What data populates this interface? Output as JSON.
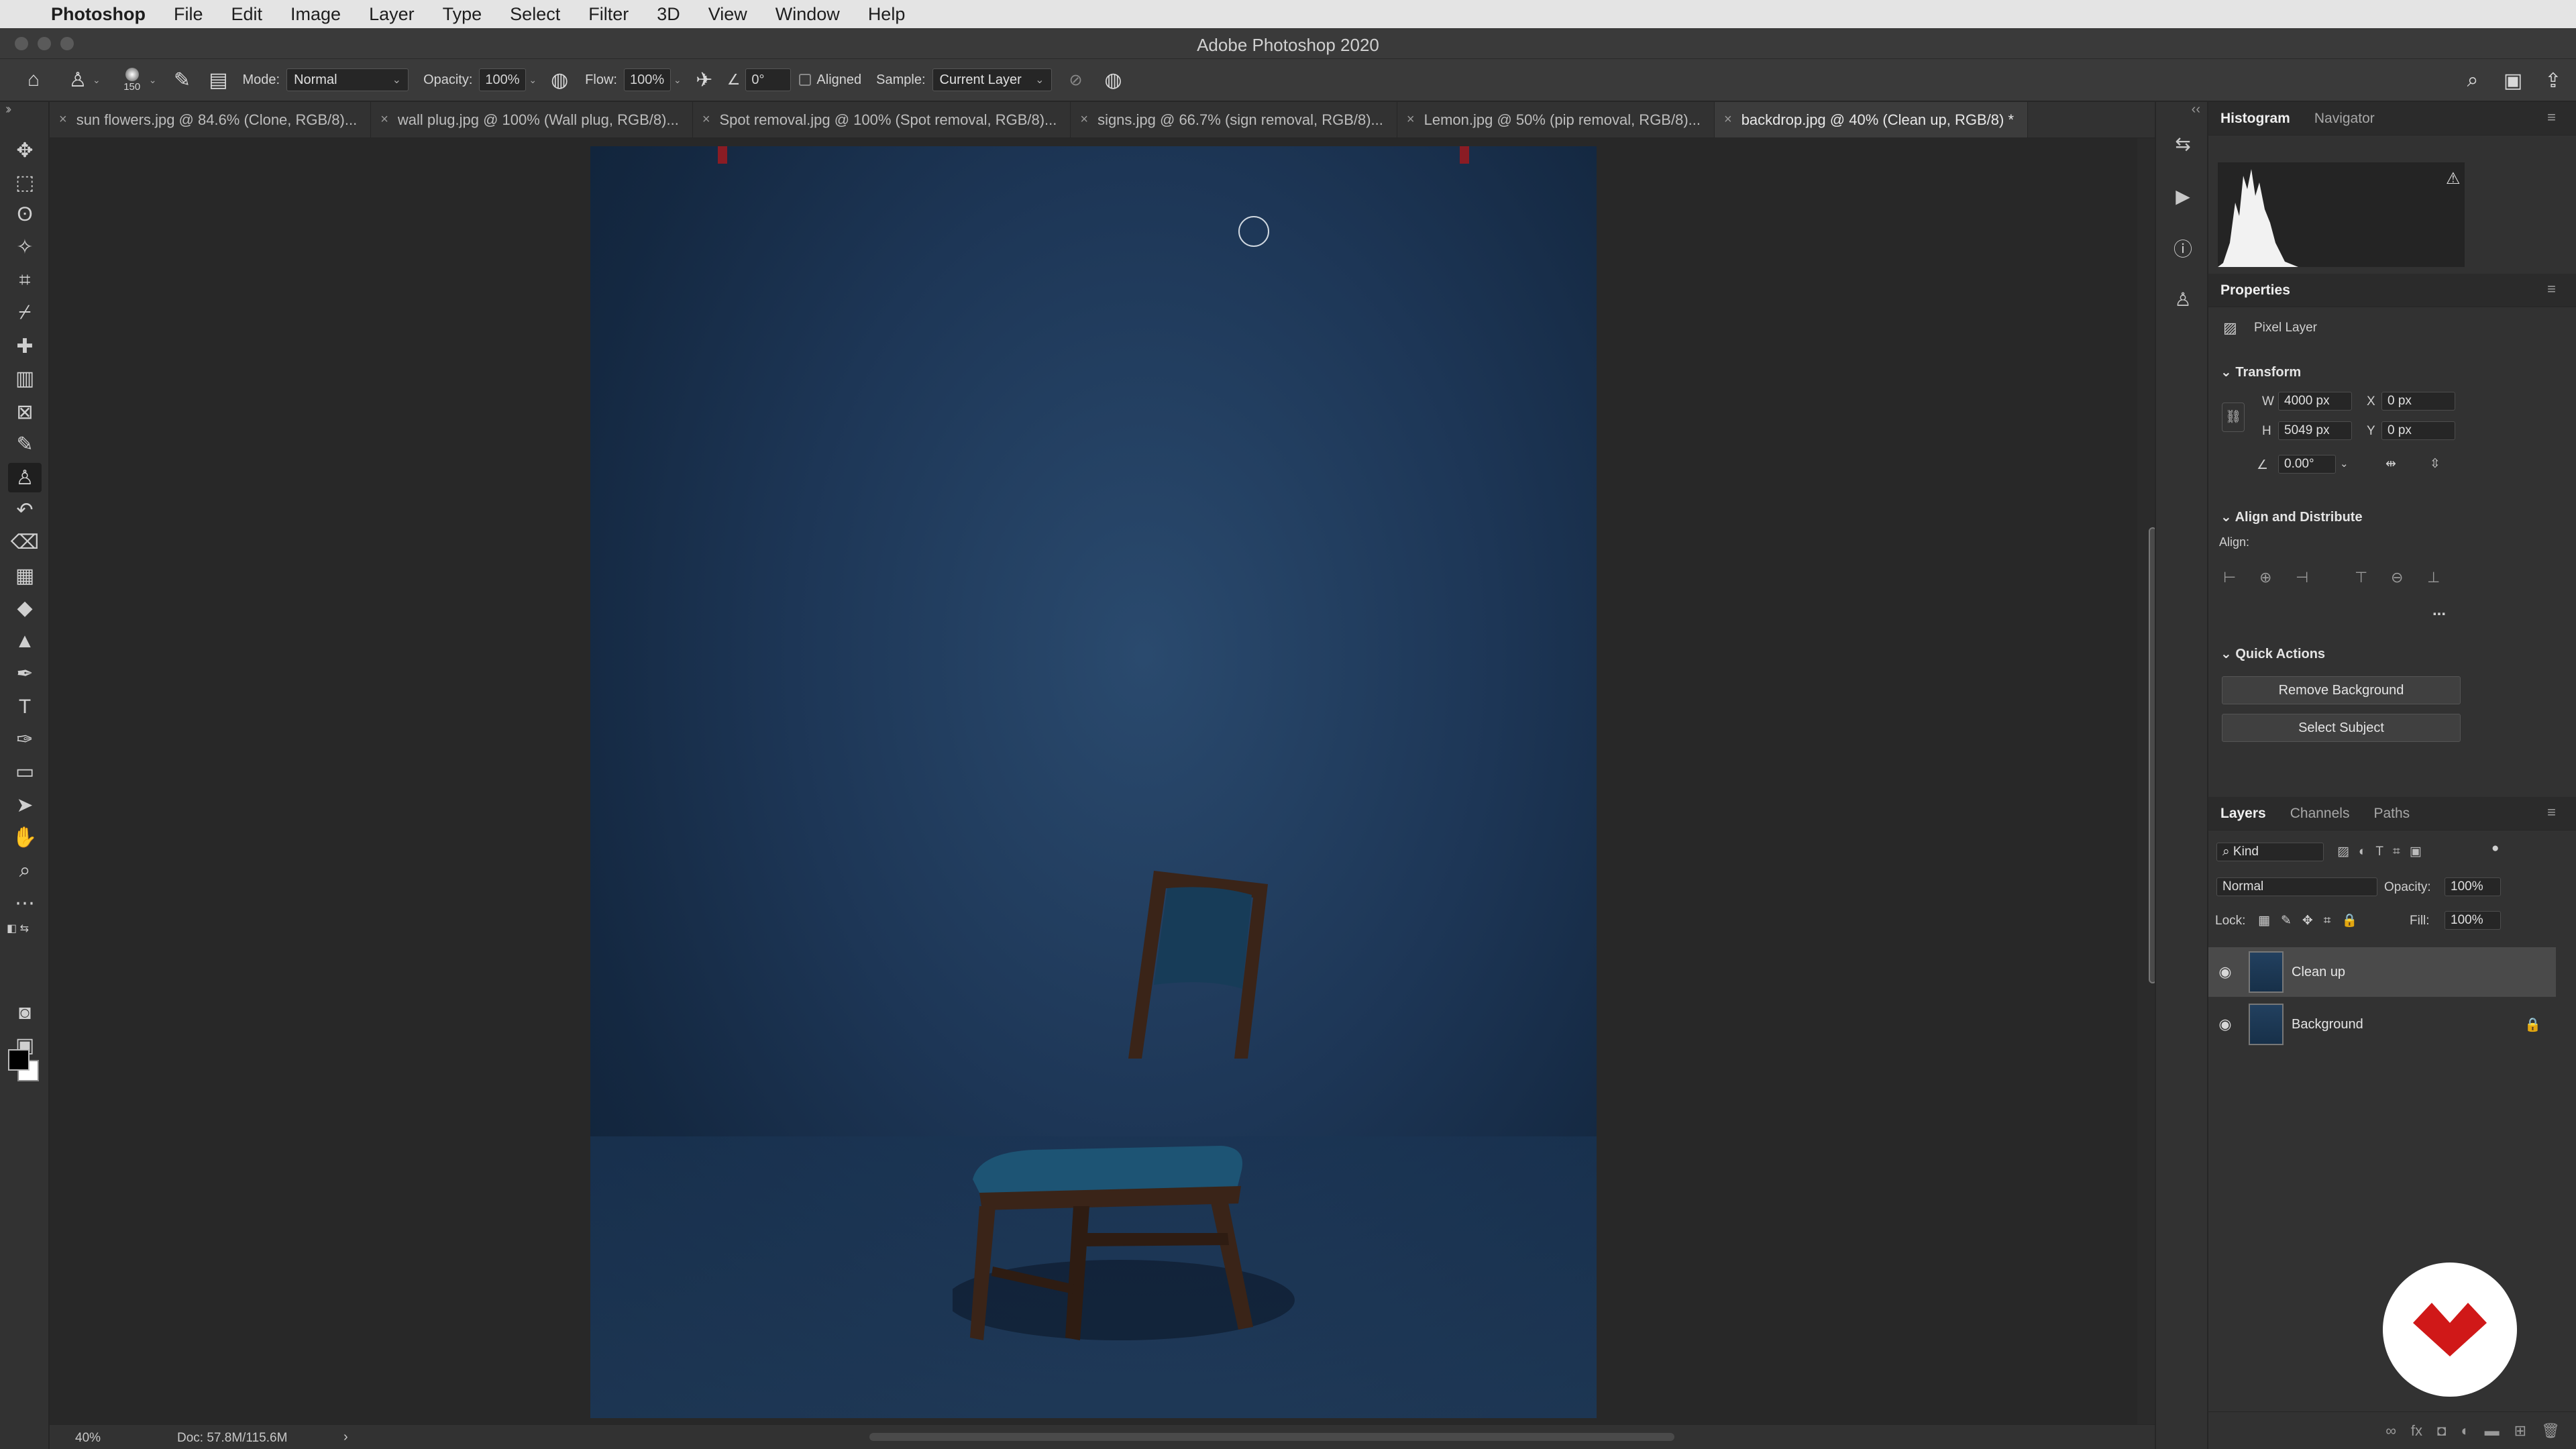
{
  "menubar": {
    "app": "Photoshop",
    "items": [
      "File",
      "Edit",
      "Image",
      "Layer",
      "Type",
      "Select",
      "Filter",
      "3D",
      "View",
      "Window",
      "Help"
    ]
  },
  "window": {
    "title": "Adobe Photoshop 2020"
  },
  "options": {
    "brush_size": "150",
    "mode_label": "Mode:",
    "mode_value": "Normal",
    "opacity_label": "Opacity:",
    "opacity_value": "100%",
    "flow_label": "Flow:",
    "flow_value": "100%",
    "angle_value": "0°",
    "aligned_label": "Aligned",
    "sample_label": "Sample:",
    "sample_value": "Current Layer"
  },
  "tabs": [
    {
      "label": "sun flowers.jpg @ 84.6% (Clone, RGB/8)..."
    },
    {
      "label": "wall plug.jpg @ 100% (Wall plug, RGB/8)..."
    },
    {
      "label": "Spot removal.jpg @ 100% (Spot removal, RGB/8)..."
    },
    {
      "label": "signs.jpg @ 66.7% (sign removal, RGB/8)..."
    },
    {
      "label": "Lemon.jpg @ 50% (pip removal, RGB/8)..."
    },
    {
      "label": "backdrop.jpg @ 40% (Clean up, RGB/8) *"
    }
  ],
  "status": {
    "zoom": "40%",
    "doc": "Doc: 57.8M/115.6M",
    "arrow": "›"
  },
  "histogram_panel": {
    "tabs": [
      "Histogram",
      "Navigator"
    ]
  },
  "properties": {
    "title": "Properties",
    "kind": "Pixel Layer",
    "transform": {
      "title": "Transform",
      "w_label": "W",
      "w": "4000 px",
      "h_label": "H",
      "h": "5049 px",
      "x_label": "X",
      "x": "0 px",
      "y_label": "Y",
      "y": "0 px",
      "angle": "0.00°"
    },
    "align": {
      "title": "Align and Distribute",
      "label": "Align:",
      "more": "..."
    },
    "quick_actions": {
      "title": "Quick Actions",
      "remove_bg": "Remove Background",
      "select_subject": "Select Subject"
    }
  },
  "layers_panel": {
    "tabs": [
      "Layers",
      "Channels",
      "Paths"
    ],
    "filter": "Kind",
    "blend": "Normal",
    "opacity_label": "Opacity:",
    "opacity": "100%",
    "lock_label": "Lock:",
    "fill_label": "Fill:",
    "fill": "100%",
    "layers": [
      {
        "name": "Clean up",
        "selected": true
      },
      {
        "name": "Background",
        "locked": true
      }
    ]
  },
  "colors": {
    "accent_logo": "#d01818",
    "image_bg": "#1d3656"
  },
  "icons": [
    "home-icon",
    "clone-stamp-icon",
    "move-icon",
    "marquee-icon",
    "lasso-icon",
    "crop-icon",
    "eyedropper-icon",
    "brush-icon",
    "eraser-icon",
    "type-icon",
    "hand-icon",
    "zoom-icon",
    "eye-icon",
    "lock-icon",
    "search-icon"
  ]
}
